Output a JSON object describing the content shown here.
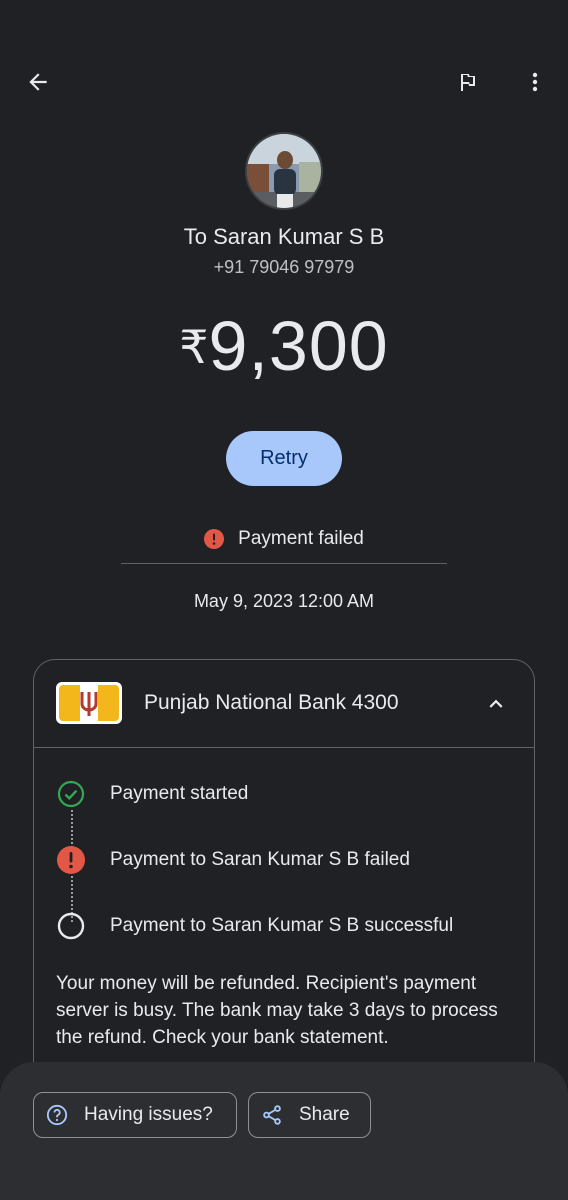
{
  "topbar": {
    "back_icon": "arrow-left-icon",
    "flag_icon": "flag-icon",
    "more_icon": "more-vertical-icon"
  },
  "recipient": {
    "name_line": "To Saran Kumar S B",
    "phone": "+91 79046 97979"
  },
  "amount": {
    "currency_symbol": "₹",
    "value": "9,300"
  },
  "actions": {
    "retry_label": "Retry"
  },
  "status": {
    "text": "Payment failed",
    "icon": "error-icon",
    "color": "#e25745"
  },
  "timestamp": "May 9, 2023 12:00 AM",
  "card": {
    "bank_name": "Punjab National Bank 4300",
    "steps": [
      {
        "label": "Payment started",
        "state": "done",
        "icon": "check-circle-icon"
      },
      {
        "label": "Payment to Saran Kumar S B failed",
        "state": "failed",
        "icon": "error-icon"
      },
      {
        "label": "Payment to Saran Kumar S B successful",
        "state": "pending",
        "icon": "empty-circle-icon"
      }
    ],
    "note": "Your money will be refunded. Recipient's payment server is busy. The bank may take 3 days to process the refund. Check your bank statement."
  },
  "bottom": {
    "issues_label": "Having issues?",
    "share_label": "Share"
  },
  "colors": {
    "accent": "#a8c7fa",
    "success": "#34a853",
    "error": "#e25745",
    "background": "#202124"
  }
}
